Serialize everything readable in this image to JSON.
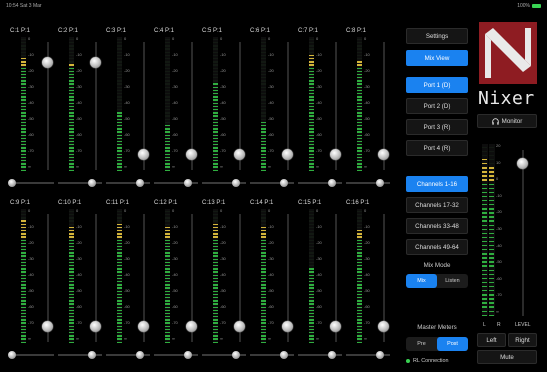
{
  "status": {
    "time": "10:54",
    "date": "Sat 3 Mar",
    "battery": "100%"
  },
  "channels": [
    {
      "label": "C:1 P:1",
      "level": 0.85,
      "fader": 0.84
    },
    {
      "label": "C:2 P:1",
      "level": 0.8,
      "fader": 0.84
    },
    {
      "label": "C:3 P:1",
      "level": 0.45,
      "fader": 0.08
    },
    {
      "label": "C:4 P:1",
      "level": 0.35,
      "fader": 0.08
    },
    {
      "label": "C:5 P:1",
      "level": 0.65,
      "fader": 0.08
    },
    {
      "label": "C:6 P:1",
      "level": 0.38,
      "fader": 0.08
    },
    {
      "label": "C:7 P:1",
      "level": 0.88,
      "fader": 0.08
    },
    {
      "label": "C:8 P:1",
      "level": 0.82,
      "fader": 0.08
    },
    {
      "label": "C:9 P:1",
      "level": 0.92,
      "fader": 0.08
    },
    {
      "label": "C:10 P:1",
      "level": 0.88,
      "fader": 0.08
    },
    {
      "label": "C:11 P:1",
      "level": 0.9,
      "fader": 0.08
    },
    {
      "label": "C:12 P:1",
      "level": 0.87,
      "fader": 0.08
    },
    {
      "label": "C:13 P:1",
      "level": 0.9,
      "fader": 0.08
    },
    {
      "label": "C:14 P:1",
      "level": 0.88,
      "fader": 0.08
    },
    {
      "label": "C:15 P:1",
      "level": 0.55,
      "fader": 0.08
    },
    {
      "label": "C:16 P:1",
      "level": 0.85,
      "fader": 0.08
    }
  ],
  "scale_labels": [
    "0",
    "-10",
    "-20",
    "-30",
    "-40",
    "-50",
    "-60",
    "-70",
    "∞"
  ],
  "controls": {
    "settings": "Settings",
    "mix_view": "Mix View",
    "ports": [
      "Port 1 (D)",
      "Port 2 (D)",
      "Port 3 (R)",
      "Port 4 (R)"
    ],
    "channel_ranges": [
      "Channels 1-16",
      "Channels 17-32",
      "Channels 33-48",
      "Channels 49-64"
    ],
    "mix_mode_label": "Mix Mode",
    "mix_mode": [
      "Mix",
      "Listen"
    ],
    "master_meters_label": "Master Meters",
    "master_meters": [
      "Pre",
      "Post"
    ],
    "connection": "RL Connection"
  },
  "right": {
    "brand": "Nixer",
    "monitor": "Monitor",
    "master_scale": [
      "20",
      "10",
      "0",
      "-10",
      "-20",
      "-30",
      "-40",
      "-50",
      "-60",
      "-70",
      "∞"
    ],
    "master_left_level": 0.92,
    "master_right_level": 0.88,
    "master_fader": 0.92,
    "meter_labels": [
      "L",
      "R",
      "LEVEL"
    ],
    "left": "Left",
    "right": "Right",
    "mute": "Mute"
  },
  "colors": {
    "accent": "#1a82f0",
    "logo": "#8e1c22",
    "meter_green": "#2fae3f",
    "meter_yellow": "#d4b53a",
    "meter_red": "#c0392b"
  }
}
